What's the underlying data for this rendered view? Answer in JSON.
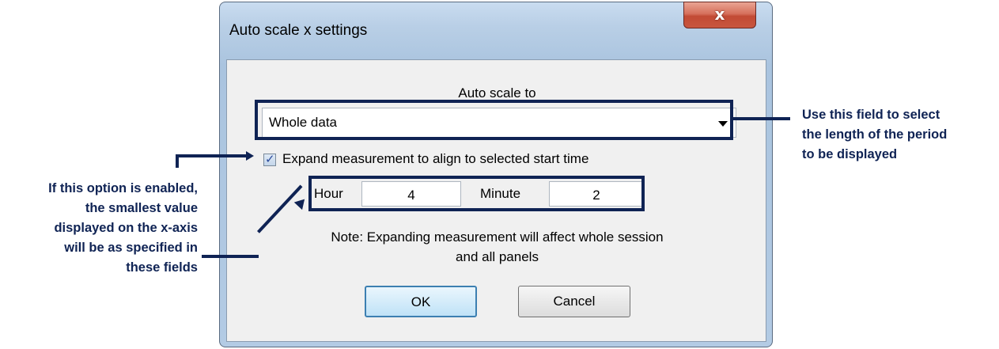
{
  "dialog": {
    "title": "Auto scale x settings",
    "close_glyph": "x",
    "auto_scale_label": "Auto scale to",
    "auto_scale_value": "Whole data",
    "expand_checkbox_checked": true,
    "expand_label": "Expand measurement to align to selected start time",
    "hour_label": "Hour",
    "hour_value": "4",
    "minute_label": "Minute",
    "minute_value": "2",
    "note_line1": "Note: Expanding measurement will affect whole session",
    "note_line2": "and all panels",
    "ok_label": "OK",
    "cancel_label": "Cancel"
  },
  "annotations": {
    "right": [
      "Use this field to select",
      "the length of the period",
      "to be displayed"
    ],
    "left": [
      "If this option is enabled,",
      "the smallest value",
      "displayed on the x-axis",
      "will be as specified in",
      "these fields"
    ]
  },
  "colors": {
    "annotation": "#0f2354",
    "close_button": "#c8563f",
    "window_frame": "#b9cfe6"
  }
}
